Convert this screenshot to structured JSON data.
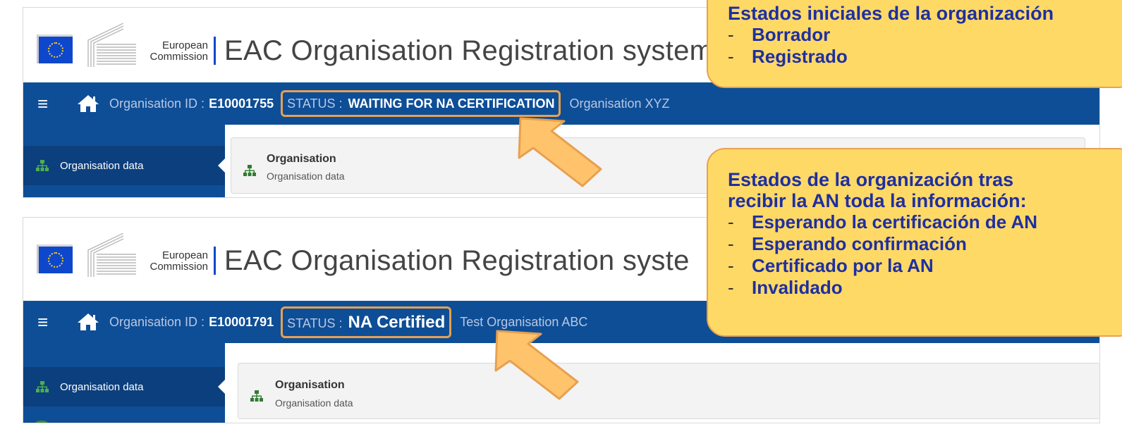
{
  "screens": [
    {
      "ec_line1": "European",
      "ec_line2": "Commission",
      "app_title": "EAC Organisation Registration system",
      "org_id_label": "Organisation ID :",
      "org_id": "E10001755",
      "status_label": "STATUS :",
      "status_value": "WAITING FOR NA CERTIFICATION",
      "org_name": "Organisation XYZ",
      "sidebar_item": "Organisation data",
      "panel_title": "Organisation",
      "panel_subtitle": "Organisation data"
    },
    {
      "ec_line1": "European",
      "ec_line2": "Commission",
      "app_title": "EAC Organisation Registration syste",
      "org_id_label": "Organisation ID :",
      "org_id": "E10001791",
      "status_label": "STATUS :",
      "status_value": "NA Certified",
      "org_name": "Test Organisation ABC",
      "sidebar_item": "Organisation data",
      "panel_title": "Organisation",
      "panel_subtitle": "Organisation data"
    }
  ],
  "callouts": [
    {
      "heading": [
        "Estados iniciales de la organización"
      ],
      "items": [
        "Borrador",
        "Registrado"
      ]
    },
    {
      "heading": [
        "Estados de la organización tras",
        "recibir la AN toda la información:"
      ],
      "items": [
        "Esperando la certificación de AN",
        "Esperando confirmación",
        "Certificado por la AN",
        "Invalidado"
      ]
    }
  ],
  "bullet": "-",
  "colors": {
    "navbar": "#0e4e96",
    "sidebar_active": "#0c3f7d",
    "callout_fill": "#ffd966",
    "callout_border": "#e8a050",
    "callout_text": "#1f2fa0",
    "arrow": "#ffc46b"
  },
  "icons": [
    "eu-flag-icon",
    "commission-building-icon",
    "hamburger-menu-icon",
    "home-icon",
    "sitemap-icon",
    "arrow-pointer-icon"
  ]
}
